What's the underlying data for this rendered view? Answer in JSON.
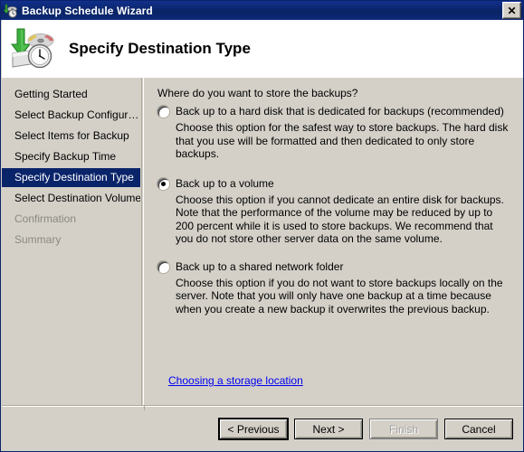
{
  "window": {
    "title": "Backup Schedule Wizard",
    "title_icon": "backup-schedule-icon",
    "close_label": "✕"
  },
  "header": {
    "icon": "backup-disk-clock-icon",
    "title": "Specify Destination Type"
  },
  "sidebar": {
    "items": [
      {
        "label": "Getting Started",
        "state": "normal"
      },
      {
        "label": "Select Backup Configur…",
        "state": "normal"
      },
      {
        "label": "Select Items for Backup",
        "state": "normal"
      },
      {
        "label": "Specify Backup Time",
        "state": "normal"
      },
      {
        "label": "Specify Destination Type",
        "state": "selected"
      },
      {
        "label": "Select Destination Volume",
        "state": "normal"
      },
      {
        "label": "Confirmation",
        "state": "disabled"
      },
      {
        "label": "Summary",
        "state": "disabled"
      }
    ]
  },
  "main": {
    "prompt": "Where do you want to store the backups?",
    "options": [
      {
        "label": "Back up to a hard disk that is dedicated for backups (recommended)",
        "description": "Choose this option for the safest way to store backups. The hard disk that you use will be formatted and then dedicated to only store backups.",
        "checked": false
      },
      {
        "label": "Back up to a volume",
        "description": "Choose this option if you cannot dedicate an entire disk for backups. Note that the performance of the volume may be reduced by up to 200 percent while it is used to store backups. We recommend that you do not store other server data on the same volume.",
        "checked": true
      },
      {
        "label": "Back up to a shared network folder",
        "description": "Choose this option if you do not want to store backups locally on the server. Note that you will only have one backup at a time because when you create a new backup it overwrites the previous backup.",
        "checked": false
      }
    ],
    "help_link": "Choosing a storage location"
  },
  "footer": {
    "buttons": [
      {
        "label": "< Previous",
        "state": "default"
      },
      {
        "label": "Next >",
        "state": "normal"
      },
      {
        "label": "Finish",
        "state": "disabled"
      },
      {
        "label": "Cancel",
        "state": "normal"
      }
    ]
  },
  "colors": {
    "titlebar": "#0a2464",
    "selection": "#0a246a",
    "face": "#d4d0c8",
    "link": "#0000ee"
  }
}
